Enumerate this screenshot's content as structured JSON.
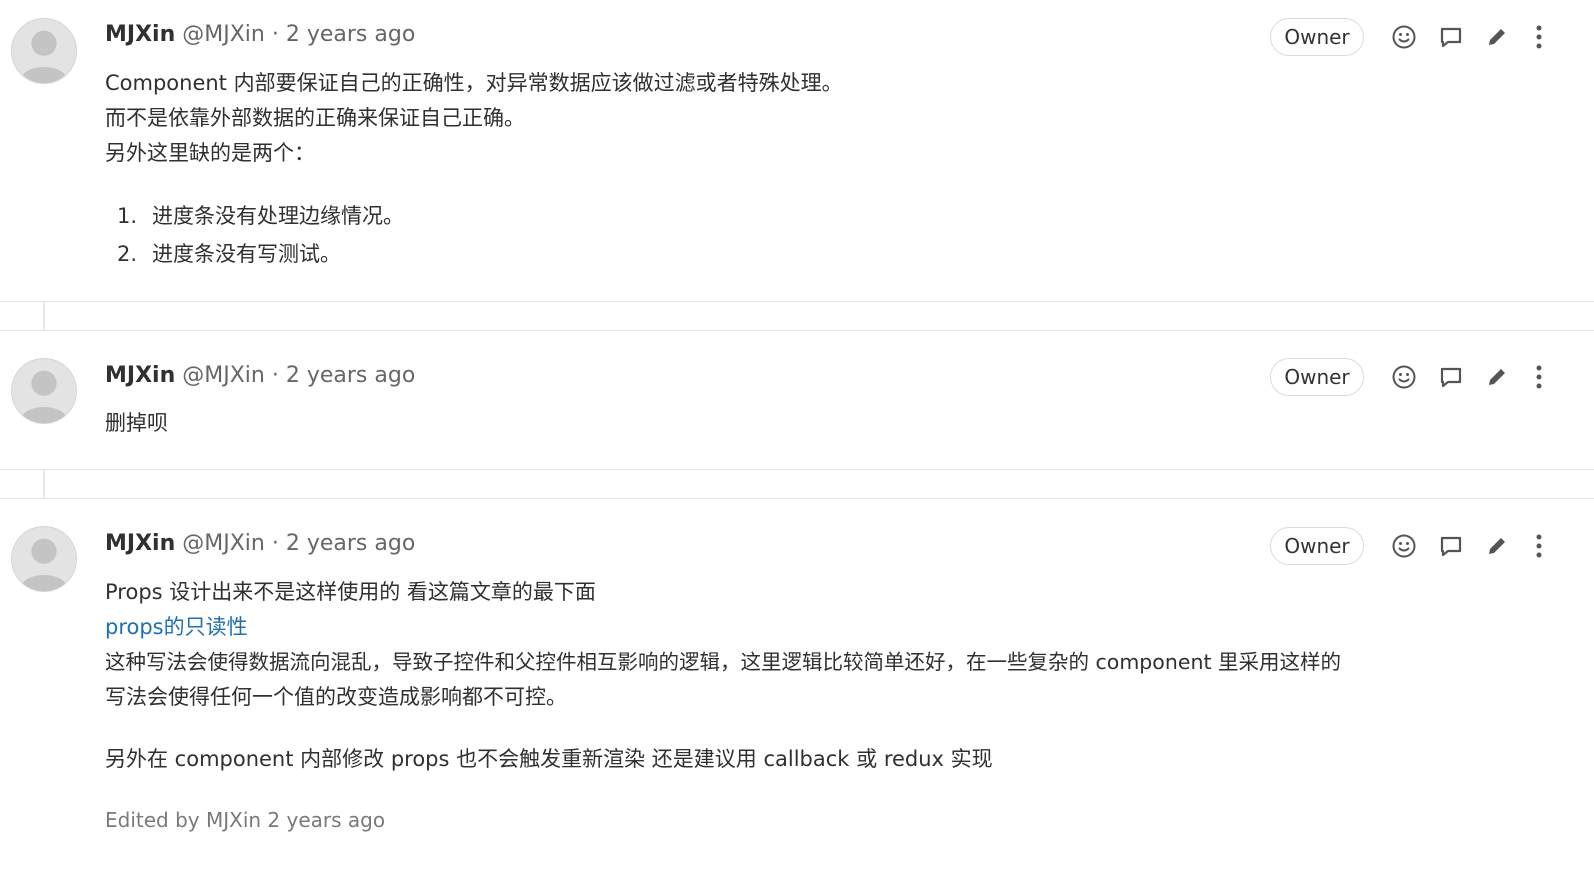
{
  "notes": [
    {
      "author_name": "MJXin",
      "author_handle": "@MJXin",
      "separator": "·",
      "timestamp": "2 years ago",
      "badge": "Owner",
      "lines": [
        "Component 内部要保证自己的正确性，对异常数据应该做过滤或者特殊处理。",
        "而不是依靠外部数据的正确来保证自己正确。",
        "另外这里缺的是两个："
      ],
      "list": [
        {
          "num": "1.",
          "text": "进度条没有处理边缘情况。"
        },
        {
          "num": "2.",
          "text": "进度条没有写测试。"
        }
      ]
    },
    {
      "author_name": "MJXin",
      "author_handle": "@MJXin",
      "separator": "·",
      "timestamp": "2 years ago",
      "badge": "Owner",
      "lines": [
        "删掉呗"
      ]
    },
    {
      "author_name": "MJXin",
      "author_handle": "@MJXin",
      "separator": "·",
      "timestamp": "2 years ago",
      "badge": "Owner",
      "line1": "Props 设计出来不是这样使用的 看这篇文章的最下面",
      "link": "props的只读性",
      "line3": "这种写法会使得数据流向混乱，导致子控件和父控件相互影响的逻辑，这里逻辑比较简单还好，在一些复杂的 component 里采用这样的",
      "line4": "写法会使得任何一个值的改变造成影响都不可控。",
      "line5": "另外在 component 内部修改 props 也不会触发重新渲染 还是建议用 callback 或 redux 实现",
      "edited": "Edited by MJXin 2 years ago"
    }
  ],
  "icons": {
    "emoji": "smiley-icon",
    "reply": "reply-bubble-icon",
    "edit": "pencil-icon",
    "more": "more-vertical-icon"
  },
  "colors": {
    "link": "#1f6fb5",
    "muted": "#666666",
    "divider": "#e3e3e3"
  }
}
